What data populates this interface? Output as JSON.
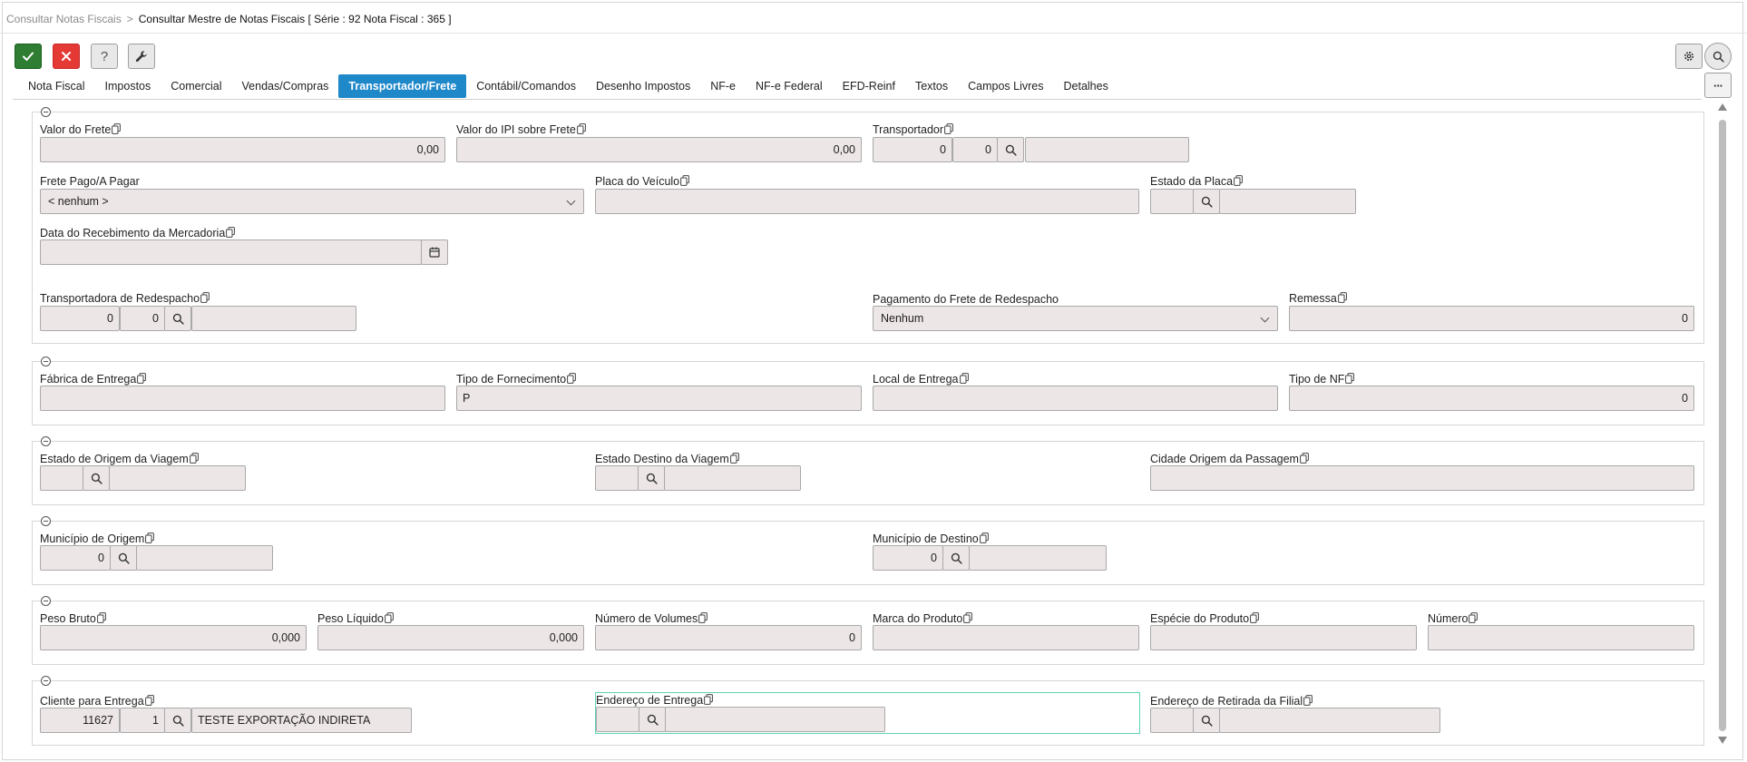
{
  "breadcrumb": {
    "parent": "Consultar Notas Fiscais",
    "separator": ">",
    "current": "Consultar Mestre de Notas Fiscais [ Série : 92 Nota Fiscal : 365 ]"
  },
  "toolbar": {
    "confirm_icon": "check-icon",
    "cancel_icon": "close-icon",
    "help_label": "?",
    "tools_icon": "wrench-icon",
    "settings_icon": "gear-icon",
    "search_icon": "search-icon"
  },
  "tabs": [
    {
      "label": "Nota Fiscal"
    },
    {
      "label": "Impostos"
    },
    {
      "label": "Comercial"
    },
    {
      "label": "Vendas/Compras"
    },
    {
      "label": "Transportador/Frete",
      "active": true
    },
    {
      "label": "Contábil/Comandos"
    },
    {
      "label": "Desenho Impostos"
    },
    {
      "label": "NF-e"
    },
    {
      "label": "NF-e Federal"
    },
    {
      "label": "EFD-Reinf"
    },
    {
      "label": "Textos"
    },
    {
      "label": "Campos Livres"
    },
    {
      "label": "Detalhes"
    }
  ],
  "more_label": "···",
  "frete": {
    "valor_frete": {
      "label": "Valor do Frete",
      "value": "0,00"
    },
    "valor_ipi_frete": {
      "label": "Valor do IPI sobre Frete",
      "value": "0,00"
    },
    "transportador": {
      "label": "Transportador",
      "code1": "0",
      "code2": "0",
      "name": ""
    },
    "frete_pago": {
      "label": "Frete Pago/A Pagar",
      "value": "< nenhum >"
    },
    "placa_veiculo": {
      "label": "Placa do Veículo",
      "value": ""
    },
    "estado_placa": {
      "label": "Estado da Placa",
      "code": "",
      "name": ""
    },
    "data_recebimento": {
      "label": "Data do Recebimento da Mercadoria",
      "value": ""
    },
    "transp_redespacho": {
      "label": "Transportadora de Redespacho",
      "code1": "0",
      "code2": "0",
      "name": ""
    },
    "pagamento_redespacho": {
      "label": "Pagamento do Frete de Redespacho",
      "value": "Nenhum"
    },
    "remessa": {
      "label": "Remessa",
      "value": "0"
    }
  },
  "entrega": {
    "fabrica": {
      "label": "Fábrica de Entrega",
      "value": ""
    },
    "tipo_fornecimento": {
      "label": "Tipo de Fornecimento",
      "value": "P"
    },
    "local_entrega": {
      "label": "Local de Entrega",
      "value": ""
    },
    "tipo_nf": {
      "label": "Tipo de NF",
      "value": "0"
    }
  },
  "viagem": {
    "estado_origem": {
      "label": "Estado de Origem da Viagem",
      "code": "",
      "name": ""
    },
    "estado_destino": {
      "label": "Estado Destino da Viagem",
      "code": "",
      "name": ""
    },
    "cidade_origem": {
      "label": "Cidade Origem da Passagem",
      "value": ""
    }
  },
  "municipio": {
    "origem": {
      "label": "Município de Origem",
      "code": "0",
      "name": ""
    },
    "destino": {
      "label": "Município de Destino",
      "code": "0",
      "name": ""
    }
  },
  "volumes": {
    "peso_bruto": {
      "label": "Peso Bruto",
      "value": "0,000"
    },
    "peso_liquido": {
      "label": "Peso Líquido",
      "value": "0,000"
    },
    "numero_volumes": {
      "label": "Número de Volumes",
      "value": "0"
    },
    "marca_produto": {
      "label": "Marca do Produto",
      "value": ""
    },
    "especie_produto": {
      "label": "Espécie do Produto",
      "value": ""
    },
    "numero": {
      "label": "Número",
      "value": ""
    }
  },
  "cliente": {
    "cliente_entrega": {
      "label": "Cliente para Entrega",
      "code1": "11627",
      "code2": "1",
      "name": "TESTE EXPORTAÇÃO INDIRETA"
    },
    "endereco_entrega": {
      "label": "Endereço de Entrega",
      "code": "",
      "name": ""
    },
    "endereco_retirada": {
      "label": "Endereço de Retirada da Filial",
      "code": "",
      "name": ""
    }
  }
}
